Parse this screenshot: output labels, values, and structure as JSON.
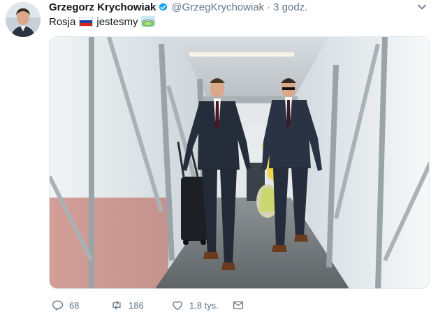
{
  "tweet": {
    "author_name": "Grzegorz Krychowiak",
    "handle": "@GrzegKrychowiak",
    "separator": "·",
    "time": "3 godz.",
    "text_before": "Rosja",
    "text_after": "jestesmy",
    "emoji_flag": "flag-russia-icon",
    "emoji_stadium": "stadium-icon"
  },
  "actions": {
    "replies": "68",
    "retweets": "186",
    "likes": "1,8 tys."
  },
  "colors": {
    "verified": "#1da1f2",
    "muted": "#657786",
    "text": "#14171a"
  }
}
